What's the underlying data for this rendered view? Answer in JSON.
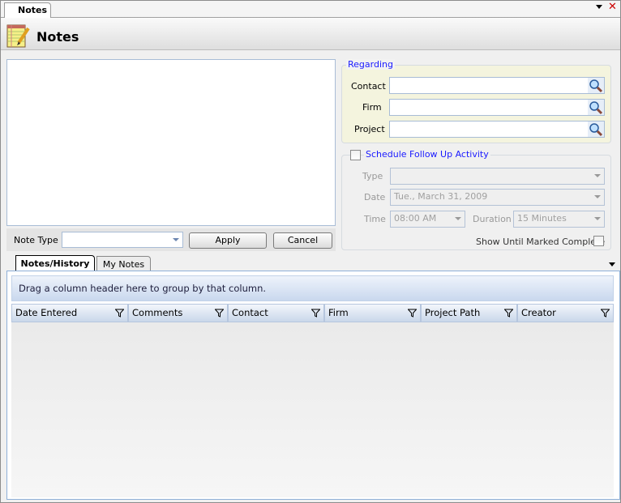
{
  "window": {
    "tab_label": "Notes",
    "title": "Notes",
    "icon": "notepad-pencil-icon"
  },
  "editor": {
    "note_text": "",
    "note_type_label": "Note Type",
    "note_type_value": "",
    "apply_label": "Apply",
    "cancel_label": "Cancel"
  },
  "regarding": {
    "legend": "Regarding",
    "fields": [
      {
        "label": "Contact",
        "value": ""
      },
      {
        "label": "Firm",
        "value": ""
      },
      {
        "label": "Project",
        "value": ""
      }
    ]
  },
  "followup": {
    "legend": "Schedule Follow Up Activity",
    "checked": false,
    "type_label": "Type",
    "type_value": "",
    "date_label": "Date",
    "date_value": "Tue., March 31, 2009",
    "time_label": "Time",
    "time_value": "08:00 AM",
    "duration_label": "Duration",
    "duration_value": "15 Minutes",
    "show_until_label": "Show Until Marked Complete",
    "show_until_checked": false
  },
  "lower": {
    "tabs": [
      {
        "label": "Notes/History",
        "active": true
      },
      {
        "label": "My Notes",
        "active": false
      }
    ],
    "group_hint": "Drag a column header here to group by that column.",
    "columns": [
      "Date Entered",
      "Comments",
      "Contact",
      "Firm",
      "Project Path",
      "Creator"
    ]
  },
  "colors": {
    "accent": "#1a1aff",
    "close": "#cc0000"
  }
}
